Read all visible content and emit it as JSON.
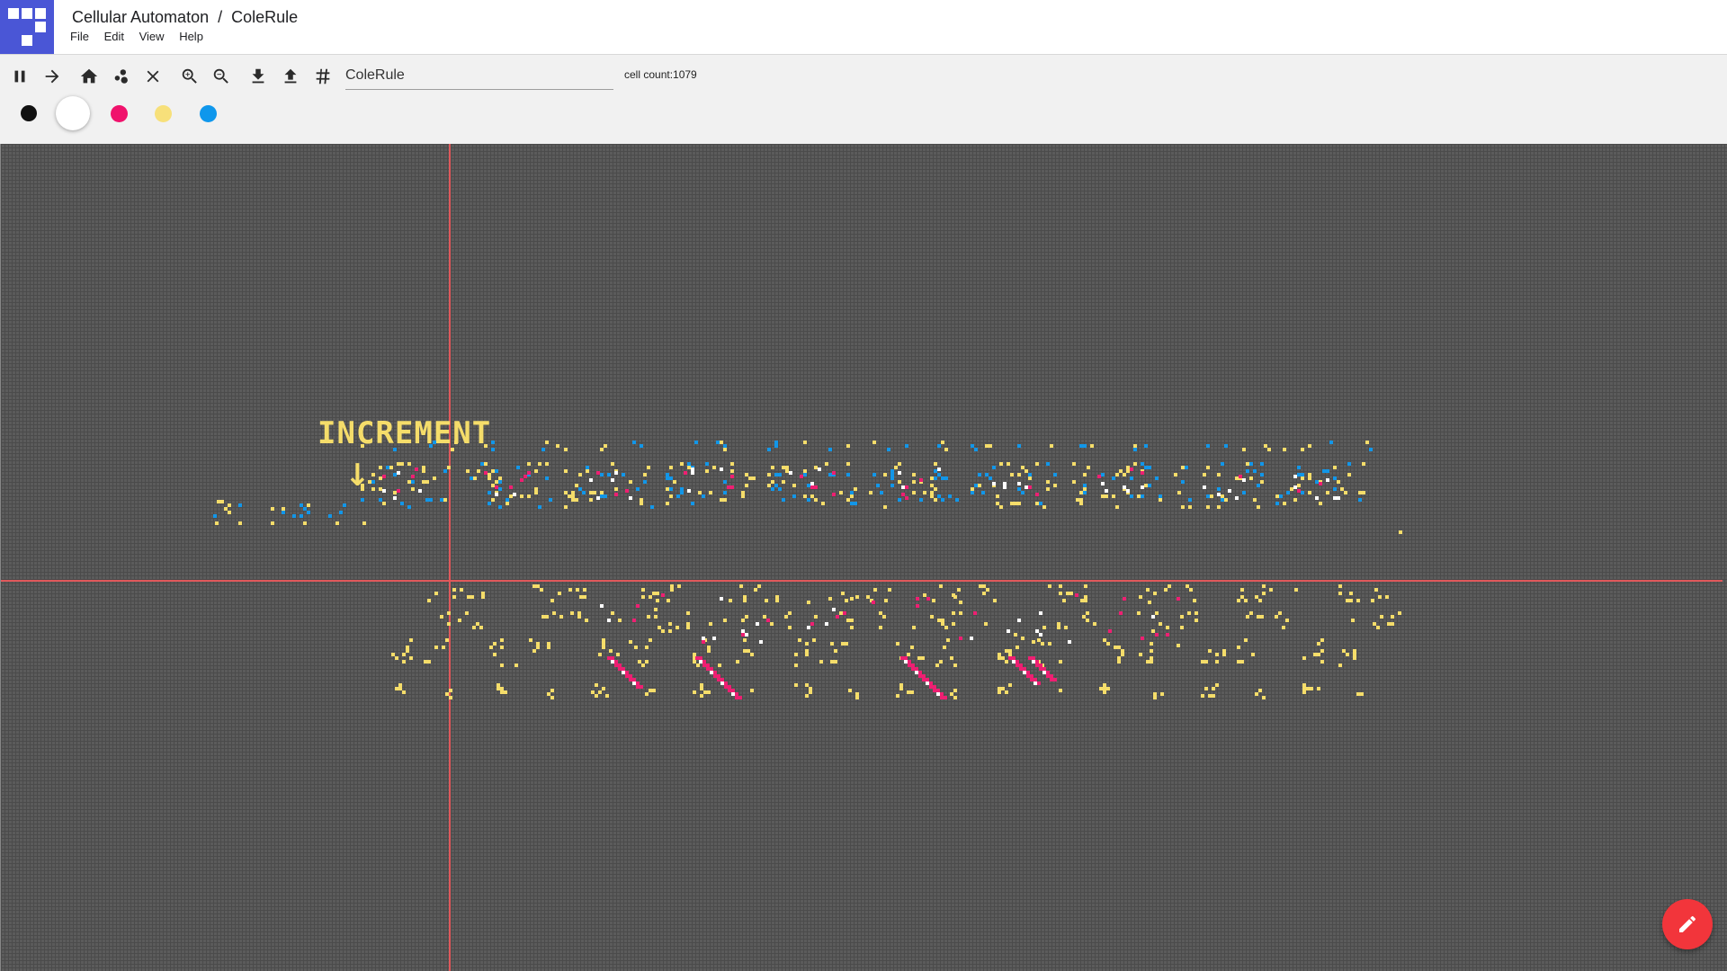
{
  "app": {
    "title": "Cellular Automaton",
    "separator": "/",
    "document": "ColeRule"
  },
  "menu": [
    "File",
    "Edit",
    "View",
    "Help"
  ],
  "toolbar": {
    "buttons": [
      "pause-icon",
      "step-forward-icon",
      "home-icon",
      "bubbles-icon",
      "clear-icon",
      "zoom-in-icon",
      "zoom-out-icon",
      "download-icon",
      "upload-icon",
      "grid-icon"
    ],
    "rule_value": "ColeRule",
    "cell_count": "cell count:1079"
  },
  "palette": [
    {
      "name": "black",
      "color": "#111111",
      "selected": false
    },
    {
      "name": "white",
      "color": "#ffffff",
      "selected": true
    },
    {
      "name": "pink",
      "color": "#f0126c",
      "selected": false
    },
    {
      "name": "yellow",
      "color": "#f7e07a",
      "selected": false
    },
    {
      "name": "blue",
      "color": "#0f97ec",
      "selected": false
    }
  ],
  "canvas": {
    "label": "INCREMENT",
    "arrow": "↓",
    "cell_colors": {
      "yellow": "#f5dd6a",
      "blue": "#1296e8",
      "pink": "#ee1f72",
      "white": "#ffffff"
    }
  },
  "fab": {
    "icon": "pencil-icon"
  }
}
